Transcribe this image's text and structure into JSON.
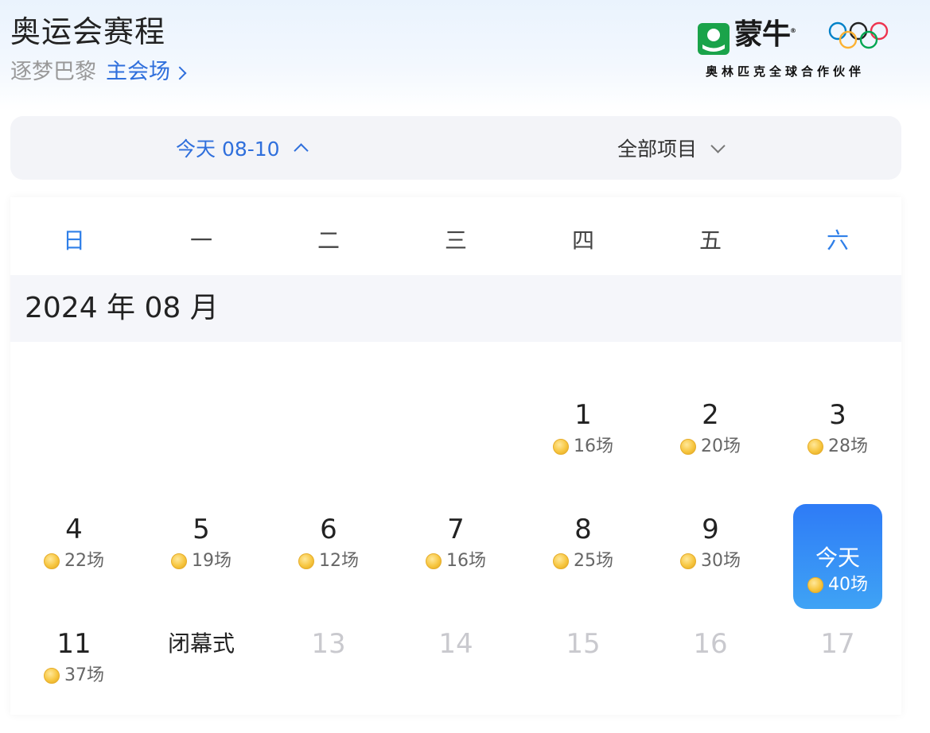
{
  "header": {
    "title": "奥运会赛程",
    "subtitle": "逐梦巴黎",
    "venue_link": "主会场"
  },
  "sponsor": {
    "brand": "蒙牛",
    "brand_mark": "®",
    "caption": "奥林匹克全球合作伙伴"
  },
  "filters": {
    "date_label": "今天 08-10",
    "category_label": "全部项目"
  },
  "calendar": {
    "weekdays": [
      "日",
      "一",
      "二",
      "三",
      "四",
      "五",
      "六"
    ],
    "month_title": "2024 年 08 月",
    "weeks": [
      [
        {
          "day": "",
          "count": ""
        },
        {
          "day": "",
          "count": ""
        },
        {
          "day": "",
          "count": ""
        },
        {
          "day": "",
          "count": ""
        },
        {
          "day": "1",
          "count": "16场"
        },
        {
          "day": "2",
          "count": "20场"
        },
        {
          "day": "3",
          "count": "28场"
        }
      ],
      [
        {
          "day": "4",
          "count": "22场"
        },
        {
          "day": "5",
          "count": "19场"
        },
        {
          "day": "6",
          "count": "12场"
        },
        {
          "day": "7",
          "count": "16场"
        },
        {
          "day": "8",
          "count": "25场"
        },
        {
          "day": "9",
          "count": "30场"
        },
        {
          "day": "今天",
          "count": "40场",
          "today": true
        }
      ],
      [
        {
          "day": "11",
          "count": "37场"
        },
        {
          "day": "闭幕式",
          "count": ""
        },
        {
          "day": "13",
          "count": "",
          "future": true
        },
        {
          "day": "14",
          "count": "",
          "future": true
        },
        {
          "day": "15",
          "count": "",
          "future": true
        },
        {
          "day": "16",
          "count": "",
          "future": true
        },
        {
          "day": "17",
          "count": "",
          "future": true
        }
      ]
    ]
  },
  "colors": {
    "accent": "#2f6fdc",
    "weekend": "#2f7fe8",
    "today_bg": "#2e7bf6",
    "brand_green": "#1aa34a"
  }
}
